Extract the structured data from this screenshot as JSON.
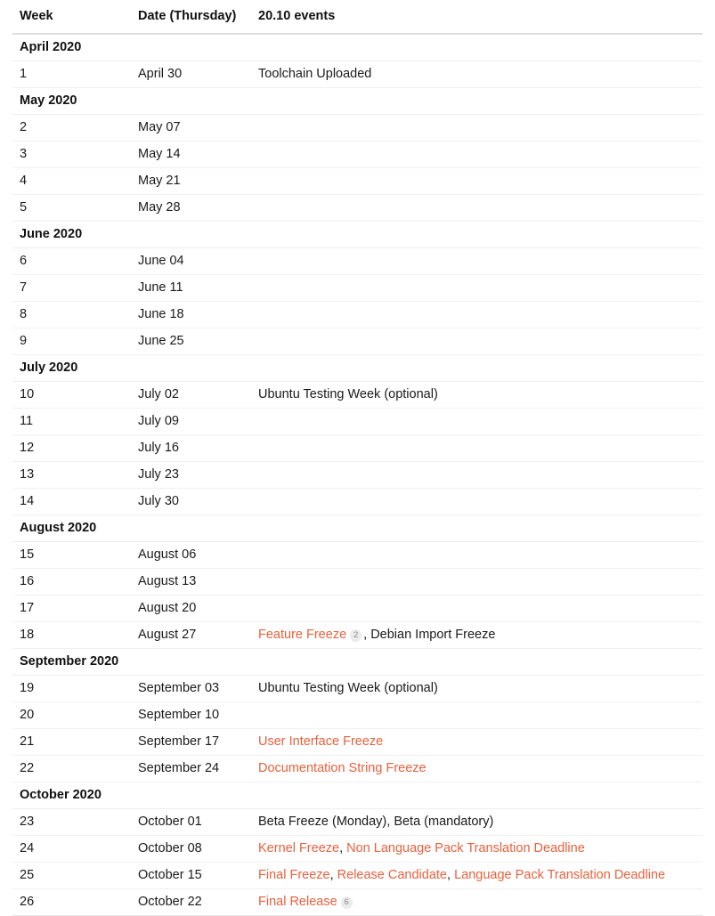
{
  "colors": {
    "accent_orange": "#e8603c",
    "text": "#1a1a1a",
    "badge_bg": "#ececec",
    "badge_text": "#8a8a8a",
    "row_border": "#f1f1f1",
    "header_border": "#dcdcdc"
  },
  "table": {
    "name": "ubuntu-20.10-release-schedule",
    "columns": [
      {
        "key": "week",
        "label": "Week"
      },
      {
        "key": "date",
        "label": "Date (Thursday)"
      },
      {
        "key": "event",
        "label": "20.10 events"
      }
    ],
    "rows": [
      {
        "type": "month",
        "label": "April 2020"
      },
      {
        "type": "week",
        "week": "1",
        "date": "April 30",
        "segments": [
          {
            "text": "Toolchain Uploaded",
            "style": "plain"
          }
        ]
      },
      {
        "type": "month",
        "label": "May 2020"
      },
      {
        "type": "week",
        "week": "2",
        "date": "May 07",
        "segments": []
      },
      {
        "type": "week",
        "week": "3",
        "date": "May 14",
        "segments": []
      },
      {
        "type": "week",
        "week": "4",
        "date": "May 21",
        "segments": []
      },
      {
        "type": "week",
        "week": "5",
        "date": "May 28",
        "segments": []
      },
      {
        "type": "month",
        "label": "June 2020"
      },
      {
        "type": "week",
        "week": "6",
        "date": "June 04",
        "segments": []
      },
      {
        "type": "week",
        "week": "7",
        "date": "June 11",
        "segments": []
      },
      {
        "type": "week",
        "week": "8",
        "date": "June 18",
        "segments": []
      },
      {
        "type": "week",
        "week": "9",
        "date": "June 25",
        "segments": []
      },
      {
        "type": "month",
        "label": "July 2020"
      },
      {
        "type": "week",
        "week": "10",
        "date": "July 02",
        "segments": [
          {
            "text": "Ubuntu Testing Week (optional)",
            "style": "plain"
          }
        ]
      },
      {
        "type": "week",
        "week": "11",
        "date": "July 09",
        "segments": []
      },
      {
        "type": "week",
        "week": "12",
        "date": "July 16",
        "segments": []
      },
      {
        "type": "week",
        "week": "13",
        "date": "July 23",
        "segments": []
      },
      {
        "type": "week",
        "week": "14",
        "date": "July 30",
        "segments": []
      },
      {
        "type": "month",
        "label": "August 2020"
      },
      {
        "type": "week",
        "week": "15",
        "date": "August 06",
        "segments": []
      },
      {
        "type": "week",
        "week": "16",
        "date": "August 13",
        "segments": []
      },
      {
        "type": "week",
        "week": "17",
        "date": "August 20",
        "segments": []
      },
      {
        "type": "week",
        "week": "18",
        "date": "August 27",
        "segments": [
          {
            "text": "Feature Freeze",
            "style": "link",
            "badge": "2"
          },
          {
            "text": ", ",
            "style": "sep"
          },
          {
            "text": "Debian Import Freeze",
            "style": "plain"
          }
        ]
      },
      {
        "type": "month",
        "label": "September 2020"
      },
      {
        "type": "week",
        "week": "19",
        "date": "September 03",
        "segments": [
          {
            "text": "Ubuntu Testing Week (optional)",
            "style": "plain"
          }
        ]
      },
      {
        "type": "week",
        "week": "20",
        "date": "September 10",
        "segments": []
      },
      {
        "type": "week",
        "week": "21",
        "date": "September 17",
        "segments": [
          {
            "text": "User Interface Freeze",
            "style": "link"
          }
        ]
      },
      {
        "type": "week",
        "week": "22",
        "date": "September 24",
        "segments": [
          {
            "text": "Documentation String Freeze",
            "style": "link"
          }
        ]
      },
      {
        "type": "month",
        "label": "October 2020"
      },
      {
        "type": "week",
        "week": "23",
        "date": "October 01",
        "segments": [
          {
            "text": "Beta Freeze (Monday), Beta (mandatory)",
            "style": "plain"
          }
        ]
      },
      {
        "type": "week",
        "week": "24",
        "date": "October 08",
        "segments": [
          {
            "text": "Kernel Freeze",
            "style": "link"
          },
          {
            "text": ", ",
            "style": "sep"
          },
          {
            "text": "Non Language Pack Translation Deadline",
            "style": "link"
          }
        ]
      },
      {
        "type": "week",
        "week": "25",
        "date": "October 15",
        "segments": [
          {
            "text": "Final Freeze",
            "style": "link"
          },
          {
            "text": ", ",
            "style": "sep"
          },
          {
            "text": "Release Candidate",
            "style": "link"
          },
          {
            "text": ", ",
            "style": "sep"
          },
          {
            "text": "Language Pack Translation Deadline",
            "style": "link"
          }
        ]
      },
      {
        "type": "week",
        "week": "26",
        "date": "October 22",
        "segments": [
          {
            "text": "Final Release",
            "style": "link",
            "badge": "6"
          }
        ]
      }
    ]
  }
}
